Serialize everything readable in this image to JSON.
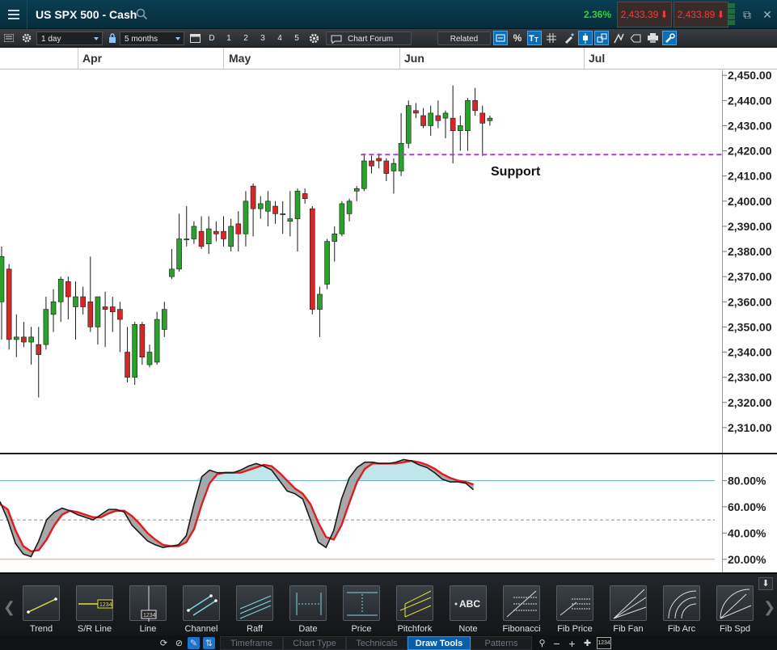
{
  "header": {
    "title": "US SPX 500 - Cash",
    "change_pct": "2.36%",
    "sell_price": "2,433.39",
    "buy_price": "2,433.89"
  },
  "toolbar": {
    "timeframe_value": "1 day",
    "range_value": "5 months",
    "period_buttons": [
      "D",
      "1",
      "2",
      "3",
      "4",
      "5"
    ],
    "chart_forum_label": "Chart Forum",
    "related_label": "Related",
    "percent_label": "%"
  },
  "date_axis": [
    "Apr",
    "May",
    "Jun",
    "Jul"
  ],
  "price_axis": [
    "2,450.00",
    "2,440.00",
    "2,430.00",
    "2,420.00",
    "2,410.00",
    "2,400.00",
    "2,390.00",
    "2,380.00",
    "2,370.00",
    "2,360.00",
    "2,350.00",
    "2,340.00",
    "2,330.00",
    "2,320.00",
    "2,310.00"
  ],
  "support_label": "Support",
  "stoch_axis": [
    "80.00%",
    "60.00%",
    "40.00%",
    "20.00%"
  ],
  "chart_data": [
    {
      "type": "candlestick",
      "series_name": "US SPX 500 - Cash",
      "ylim": [
        2300,
        2452
      ],
      "support_level": 2418.5,
      "colors": {
        "up": "#2ca02c",
        "down": "#d62728",
        "support": "#b23cd8"
      },
      "candles": [
        {
          "o": 2360,
          "h": 2382,
          "l": 2345,
          "c": 2378
        },
        {
          "o": 2373,
          "h": 2375,
          "l": 2341,
          "c": 2345
        },
        {
          "o": 2345,
          "h": 2355,
          "l": 2338,
          "c": 2346
        },
        {
          "o": 2346,
          "h": 2352,
          "l": 2342,
          "c": 2344
        },
        {
          "o": 2344,
          "h": 2350,
          "l": 2335,
          "c": 2346
        },
        {
          "o": 2343,
          "h": 2350,
          "l": 2322,
          "c": 2339
        },
        {
          "o": 2343,
          "h": 2362,
          "l": 2341,
          "c": 2357
        },
        {
          "o": 2355,
          "h": 2365,
          "l": 2348,
          "c": 2360
        },
        {
          "o": 2360,
          "h": 2370,
          "l": 2352,
          "c": 2369
        },
        {
          "o": 2368,
          "h": 2370,
          "l": 2353,
          "c": 2362
        },
        {
          "o": 2358,
          "h": 2368,
          "l": 2345,
          "c": 2362
        },
        {
          "o": 2362,
          "h": 2366,
          "l": 2355,
          "c": 2358
        },
        {
          "o": 2360,
          "h": 2378,
          "l": 2348,
          "c": 2350
        },
        {
          "o": 2350,
          "h": 2361,
          "l": 2343,
          "c": 2362
        },
        {
          "o": 2358,
          "h": 2364,
          "l": 2342,
          "c": 2357
        },
        {
          "o": 2358,
          "h": 2362,
          "l": 2348,
          "c": 2356
        },
        {
          "o": 2357,
          "h": 2360,
          "l": 2340,
          "c": 2353
        },
        {
          "o": 2340,
          "h": 2350,
          "l": 2328,
          "c": 2330
        },
        {
          "o": 2330,
          "h": 2352,
          "l": 2327,
          "c": 2351
        },
        {
          "o": 2351,
          "h": 2352,
          "l": 2335,
          "c": 2338
        },
        {
          "o": 2335,
          "h": 2343,
          "l": 2334,
          "c": 2340
        },
        {
          "o": 2336,
          "h": 2356,
          "l": 2335,
          "c": 2353
        },
        {
          "o": 2349,
          "h": 2360,
          "l": 2346,
          "c": 2357
        },
        {
          "o": 2370,
          "h": 2381,
          "l": 2369,
          "c": 2373
        },
        {
          "o": 2373,
          "h": 2395,
          "l": 2372,
          "c": 2385
        },
        {
          "o": 2385,
          "h": 2398,
          "l": 2382,
          "c": 2385
        },
        {
          "o": 2385,
          "h": 2392,
          "l": 2383,
          "c": 2390
        },
        {
          "o": 2388,
          "h": 2394,
          "l": 2381,
          "c": 2382
        },
        {
          "o": 2383,
          "h": 2394,
          "l": 2379,
          "c": 2389
        },
        {
          "o": 2388,
          "h": 2392,
          "l": 2384,
          "c": 2387
        },
        {
          "o": 2388,
          "h": 2394,
          "l": 2382,
          "c": 2385
        },
        {
          "o": 2382,
          "h": 2393,
          "l": 2380,
          "c": 2390
        },
        {
          "o": 2391,
          "h": 2396,
          "l": 2380,
          "c": 2387
        },
        {
          "o": 2387,
          "h": 2404,
          "l": 2382,
          "c": 2400
        },
        {
          "o": 2406,
          "h": 2407,
          "l": 2386,
          "c": 2397
        },
        {
          "o": 2397,
          "h": 2402,
          "l": 2393,
          "c": 2399
        },
        {
          "o": 2396,
          "h": 2404,
          "l": 2390,
          "c": 2400
        },
        {
          "o": 2398,
          "h": 2400,
          "l": 2391,
          "c": 2395
        },
        {
          "o": 2395,
          "h": 2400,
          "l": 2387,
          "c": 2395
        },
        {
          "o": 2392,
          "h": 2404,
          "l": 2386,
          "c": 2393
        },
        {
          "o": 2393,
          "h": 2405,
          "l": 2380,
          "c": 2404
        },
        {
          "o": 2403,
          "h": 2405,
          "l": 2399,
          "c": 2401
        },
        {
          "o": 2397,
          "h": 2398,
          "l": 2355,
          "c": 2357
        },
        {
          "o": 2357,
          "h": 2366,
          "l": 2346,
          "c": 2363
        },
        {
          "o": 2367,
          "h": 2385,
          "l": 2365,
          "c": 2384
        },
        {
          "o": 2384,
          "h": 2390,
          "l": 2376,
          "c": 2387
        },
        {
          "o": 2387,
          "h": 2400,
          "l": 2386,
          "c": 2399
        },
        {
          "o": 2395,
          "h": 2401,
          "l": 2392,
          "c": 2400
        },
        {
          "o": 2404,
          "h": 2406,
          "l": 2400,
          "c": 2405
        },
        {
          "o": 2405,
          "h": 2419,
          "l": 2404,
          "c": 2416
        },
        {
          "o": 2416,
          "h": 2418,
          "l": 2411,
          "c": 2414
        },
        {
          "o": 2417,
          "h": 2419,
          "l": 2413,
          "c": 2416
        },
        {
          "o": 2416,
          "h": 2417,
          "l": 2408,
          "c": 2411
        },
        {
          "o": 2412,
          "h": 2417,
          "l": 2403,
          "c": 2415
        },
        {
          "o": 2412,
          "h": 2435,
          "l": 2410,
          "c": 2423
        },
        {
          "o": 2423,
          "h": 2440,
          "l": 2421,
          "c": 2438
        },
        {
          "o": 2436,
          "h": 2439,
          "l": 2433,
          "c": 2435
        },
        {
          "o": 2434,
          "h": 2437,
          "l": 2429,
          "c": 2430
        },
        {
          "o": 2430,
          "h": 2438,
          "l": 2426,
          "c": 2435
        },
        {
          "o": 2434,
          "h": 2440,
          "l": 2429,
          "c": 2432
        },
        {
          "o": 2433,
          "h": 2436,
          "l": 2425,
          "c": 2435
        },
        {
          "o": 2433,
          "h": 2446,
          "l": 2415,
          "c": 2428
        },
        {
          "o": 2428,
          "h": 2434,
          "l": 2420,
          "c": 2430
        },
        {
          "o": 2428,
          "h": 2441,
          "l": 2420,
          "c": 2440
        },
        {
          "o": 2440,
          "h": 2445,
          "l": 2434,
          "c": 2436
        },
        {
          "o": 2435,
          "h": 2438,
          "l": 2418,
          "c": 2431
        },
        {
          "o": 2432,
          "h": 2434,
          "l": 2430,
          "c": 2433
        }
      ]
    },
    {
      "type": "line",
      "series_name": "Stochastic",
      "ylim": [
        10,
        100
      ],
      "levels": [
        20,
        50,
        80
      ],
      "colors": {
        "k": "#1a1a1a",
        "d": "#e41a1c",
        "overbought_fill": "#bfe6ea",
        "cross_fill": "#a8a8a8"
      },
      "k": [
        64,
        50,
        32,
        24,
        22,
        34,
        50,
        56,
        59,
        57,
        54,
        52,
        50,
        54,
        58,
        58,
        56,
        46,
        40,
        34,
        31,
        29,
        30,
        31,
        38,
        62,
        83,
        88,
        86,
        86,
        86,
        88,
        91,
        93,
        91,
        88,
        80,
        72,
        70,
        66,
        50,
        33,
        29,
        42,
        66,
        82,
        90,
        94,
        94,
        93,
        93,
        94,
        96,
        95,
        92,
        90,
        86,
        81,
        79,
        79,
        78,
        73
      ],
      "d": [
        62,
        58,
        42,
        30,
        26,
        27,
        35,
        46,
        54,
        57,
        56,
        54,
        52,
        52,
        55,
        57,
        57,
        53,
        47,
        40,
        35,
        31,
        30,
        30,
        33,
        43,
        62,
        78,
        85,
        86,
        86,
        86,
        88,
        90,
        92,
        91,
        86,
        80,
        74,
        70,
        62,
        48,
        37,
        35,
        46,
        63,
        79,
        89,
        93,
        93,
        93,
        93,
        94,
        95,
        94,
        92,
        89,
        85,
        82,
        80,
        79,
        77
      ]
    }
  ]
}
